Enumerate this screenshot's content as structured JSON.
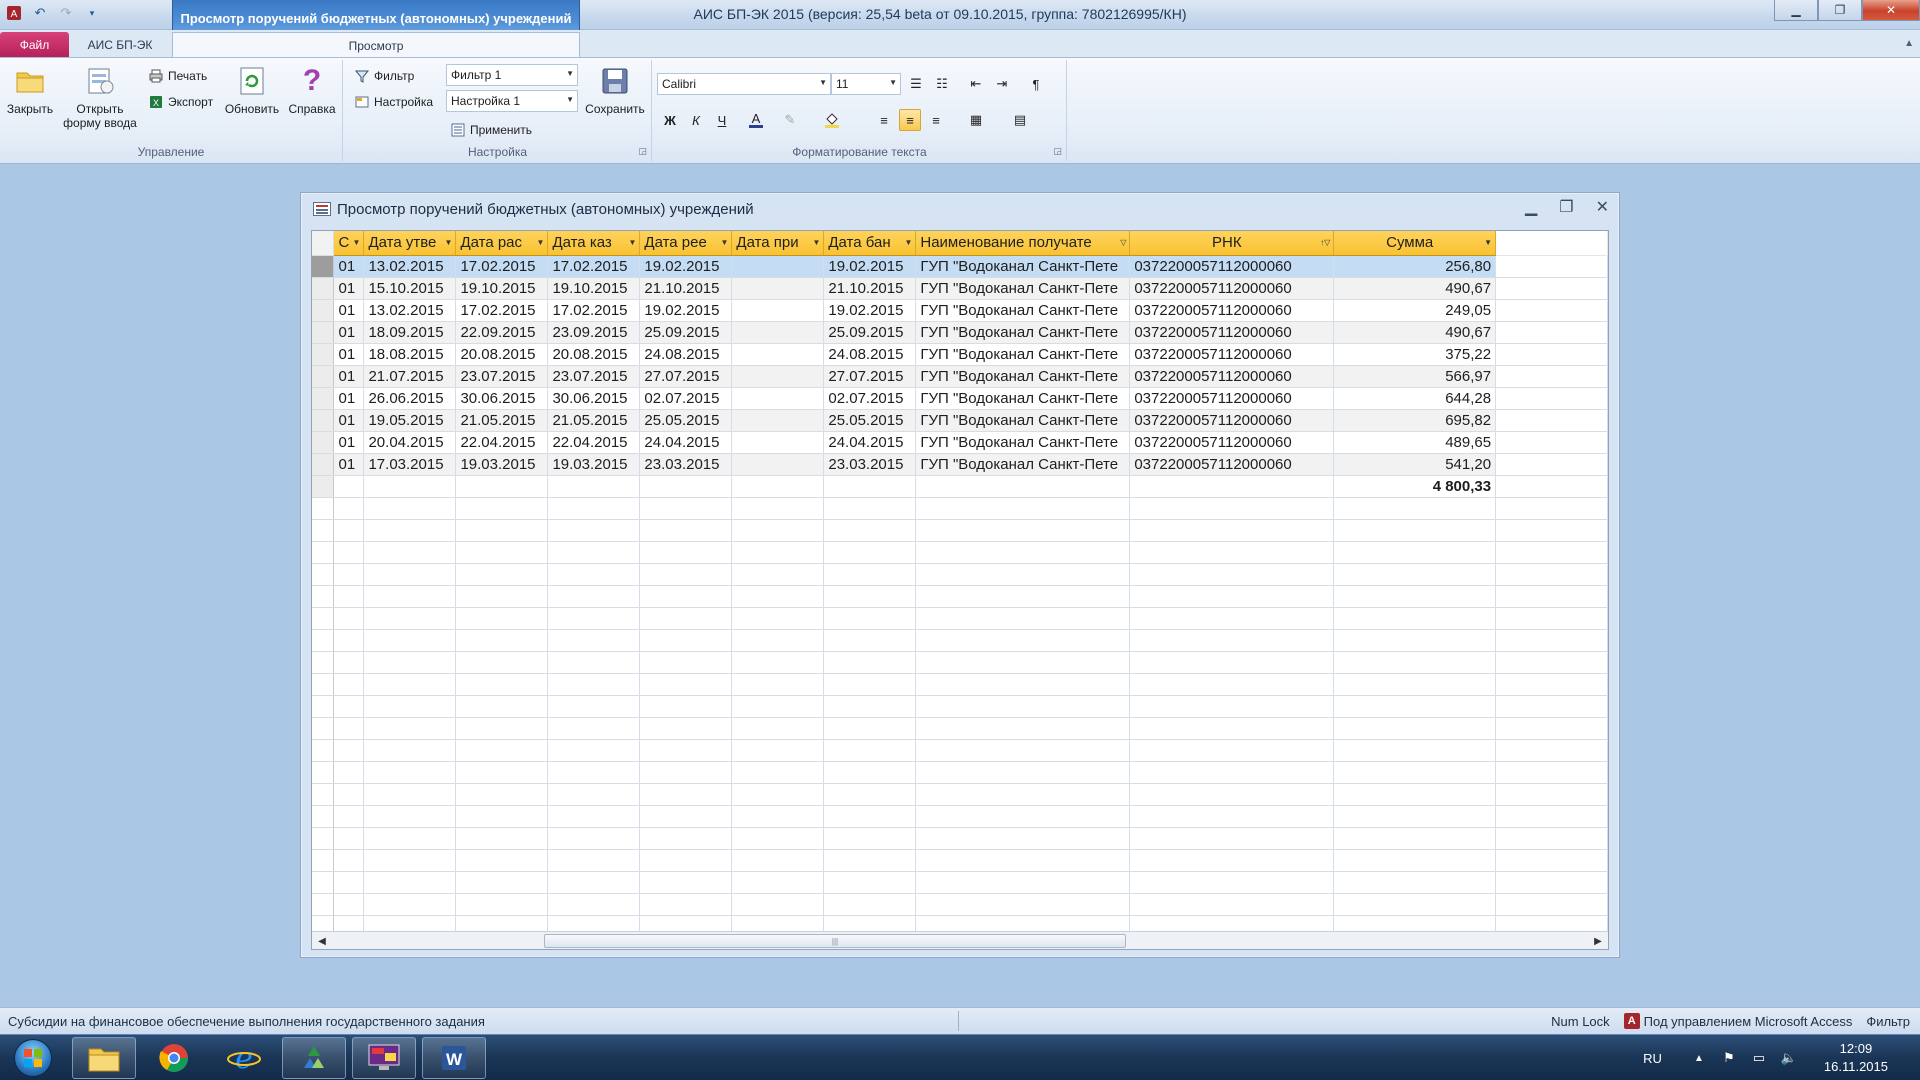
{
  "app": {
    "window_title": "АИС БП-ЭК 2015 (версия: 25,54 beta от 09.10.2015, группа: 7802126995/КН)",
    "context_tab_title": "Просмотр поручений бюджетных (автономных) учреждений"
  },
  "ribbon_tabs": {
    "file": "Файл",
    "ais": "АИС БП-ЭК",
    "view": "Просмотр"
  },
  "ribbon": {
    "manage": {
      "label": "Управление",
      "close": "Закрыть",
      "open_form_line1": "Открыть",
      "open_form_line2": "форму ввода",
      "print": "Печать",
      "export": "Экспорт",
      "refresh": "Обновить",
      "help": "Справка"
    },
    "settings": {
      "label": "Настройка",
      "filter": "Фильтр",
      "setup": "Настройка",
      "filter_value": "Фильтр 1",
      "setup_value": "Настройка 1",
      "apply": "Применить",
      "save": "Сохранить"
    },
    "format": {
      "label": "Форматирование текста",
      "font": "Calibri",
      "size": "11",
      "bold": "Ж",
      "italic": "К",
      "underline": "Ч"
    }
  },
  "form": {
    "title": "Просмотр поручений бюджетных (автономных) учреждений",
    "columns": [
      "С",
      "Дата утве",
      "Дата рас",
      "Дата каз",
      "Дата рее",
      "Дата при",
      "Дата бан",
      "Наименование получате",
      "РНК",
      "Сумма"
    ],
    "rows": [
      [
        "01",
        "13.02.2015",
        "17.02.2015",
        "17.02.2015",
        "19.02.2015",
        "",
        "19.02.2015",
        "ГУП \"Водоканал Санкт-Пете",
        "0372200057112000060",
        "256,80"
      ],
      [
        "01",
        "15.10.2015",
        "19.10.2015",
        "19.10.2015",
        "21.10.2015",
        "",
        "21.10.2015",
        "ГУП \"Водоканал Санкт-Пете",
        "0372200057112000060",
        "490,67"
      ],
      [
        "01",
        "13.02.2015",
        "17.02.2015",
        "17.02.2015",
        "19.02.2015",
        "",
        "19.02.2015",
        "ГУП \"Водоканал Санкт-Пете",
        "0372200057112000060",
        "249,05"
      ],
      [
        "01",
        "18.09.2015",
        "22.09.2015",
        "23.09.2015",
        "25.09.2015",
        "",
        "25.09.2015",
        "ГУП \"Водоканал Санкт-Пете",
        "0372200057112000060",
        "490,67"
      ],
      [
        "01",
        "18.08.2015",
        "20.08.2015",
        "20.08.2015",
        "24.08.2015",
        "",
        "24.08.2015",
        "ГУП \"Водоканал Санкт-Пете",
        "0372200057112000060",
        "375,22"
      ],
      [
        "01",
        "21.07.2015",
        "23.07.2015",
        "23.07.2015",
        "27.07.2015",
        "",
        "27.07.2015",
        "ГУП \"Водоканал Санкт-Пете",
        "0372200057112000060",
        "566,97"
      ],
      [
        "01",
        "26.06.2015",
        "30.06.2015",
        "30.06.2015",
        "02.07.2015",
        "",
        "02.07.2015",
        "ГУП \"Водоканал Санкт-Пете",
        "0372200057112000060",
        "644,28"
      ],
      [
        "01",
        "19.05.2015",
        "21.05.2015",
        "21.05.2015",
        "25.05.2015",
        "",
        "25.05.2015",
        "ГУП \"Водоканал Санкт-Пете",
        "0372200057112000060",
        "695,82"
      ],
      [
        "01",
        "20.04.2015",
        "22.04.2015",
        "22.04.2015",
        "24.04.2015",
        "",
        "24.04.2015",
        "ГУП \"Водоканал Санкт-Пете",
        "0372200057112000060",
        "489,65"
      ],
      [
        "01",
        "17.03.2015",
        "19.03.2015",
        "19.03.2015",
        "23.03.2015",
        "",
        "23.03.2015",
        "ГУП \"Водоканал Санкт-Пете",
        "0372200057112000060",
        "541,20"
      ]
    ],
    "total": "4 800,33",
    "selected_row": 0
  },
  "statusbar": {
    "left": "Субсидии на финансовое обеспечение выполнения государственного задания",
    "numlock": "Num Lock",
    "managed": "Под управлением Microsoft Access",
    "filter": "Фильтр"
  },
  "taskbar": {
    "lang": "RU",
    "time": "12:09",
    "date": "16.11.2015"
  },
  "colors": {
    "header_gold": "#f8c232",
    "selected_row": "#c5dcf5",
    "file_tab": "#b41f57",
    "context_tab": "#4f8fd6"
  }
}
